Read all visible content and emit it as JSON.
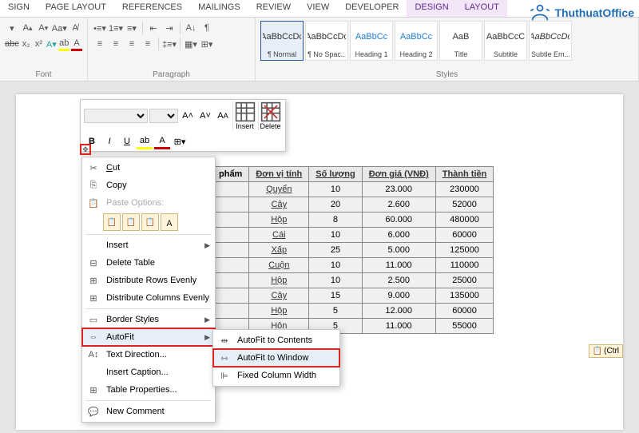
{
  "tabs": {
    "sign": "SIGN",
    "page_layout": "PAGE LAYOUT",
    "references": "REFERENCES",
    "mailings": "MAILINGS",
    "review": "REVIEW",
    "view": "VIEW",
    "developer": "DEVELOPER",
    "design": "DESIGN",
    "layout": "LAYOUT"
  },
  "groups": {
    "font": "Font",
    "paragraph": "Paragraph",
    "styles": "Styles"
  },
  "styles": {
    "items": [
      {
        "preview": "AaBbCcDc",
        "name": "¶ Normal"
      },
      {
        "preview": "AaBbCcDc",
        "name": "¶ No Spac..."
      },
      {
        "preview": "AaBbCc",
        "name": "Heading 1"
      },
      {
        "preview": "AaBbCc",
        "name": "Heading 2"
      },
      {
        "preview": "AaB",
        "name": "Title"
      },
      {
        "preview": "AaBbCcC",
        "name": "Subtitle"
      },
      {
        "preview": "AaBbCcDc",
        "name": "Subtle Em..."
      }
    ]
  },
  "logo": {
    "brand": "ThuthuatOffice"
  },
  "mini_toolbar": {
    "font_name": "",
    "font_size": "",
    "insert": "Insert",
    "delete": "Delete"
  },
  "context_menu": {
    "cut": "Cut",
    "copy": "Copy",
    "paste_options": "Paste Options:",
    "insert": "Insert",
    "delete_table": "Delete Table",
    "distribute_rows": "Distribute Rows Evenly",
    "distribute_cols": "Distribute Columns Evenly",
    "border_styles": "Border Styles",
    "autofit": "AutoFit",
    "text_direction": "Text Direction...",
    "insert_caption": "Insert Caption...",
    "table_properties": "Table Properties...",
    "new_comment": "New Comment"
  },
  "submenu": {
    "autofit_contents": "AutoFit to Contents",
    "autofit_window": "AutoFit to Window",
    "fixed_width": "Fixed Column Width"
  },
  "table": {
    "headers": [
      "phẩm",
      "Đơn vị tính",
      "Số lượng",
      "Đơn giá (VNĐ)",
      "Thành tiền"
    ],
    "rows": [
      [
        "",
        "Quyển",
        "10",
        "23.000",
        "230000"
      ],
      [
        "",
        "Cây",
        "20",
        "2.600",
        "52000"
      ],
      [
        "",
        "Hộp",
        "8",
        "60.000",
        "480000"
      ],
      [
        "",
        "Cái",
        "10",
        "6.000",
        "60000"
      ],
      [
        "",
        "Xấp",
        "25",
        "5.000",
        "125000"
      ],
      [
        "",
        "Cuộn",
        "10",
        "11.000",
        "110000"
      ],
      [
        "",
        "Hộp",
        "10",
        "2.500",
        "25000"
      ],
      [
        "",
        "Cây",
        "15",
        "9.000",
        "135000"
      ],
      [
        "",
        "Hộp",
        "5",
        "12.000",
        "60000"
      ],
      [
        "",
        "Hôn",
        "5",
        "11.000",
        "55000"
      ]
    ]
  },
  "ctrl_hint": "(Ctrl"
}
